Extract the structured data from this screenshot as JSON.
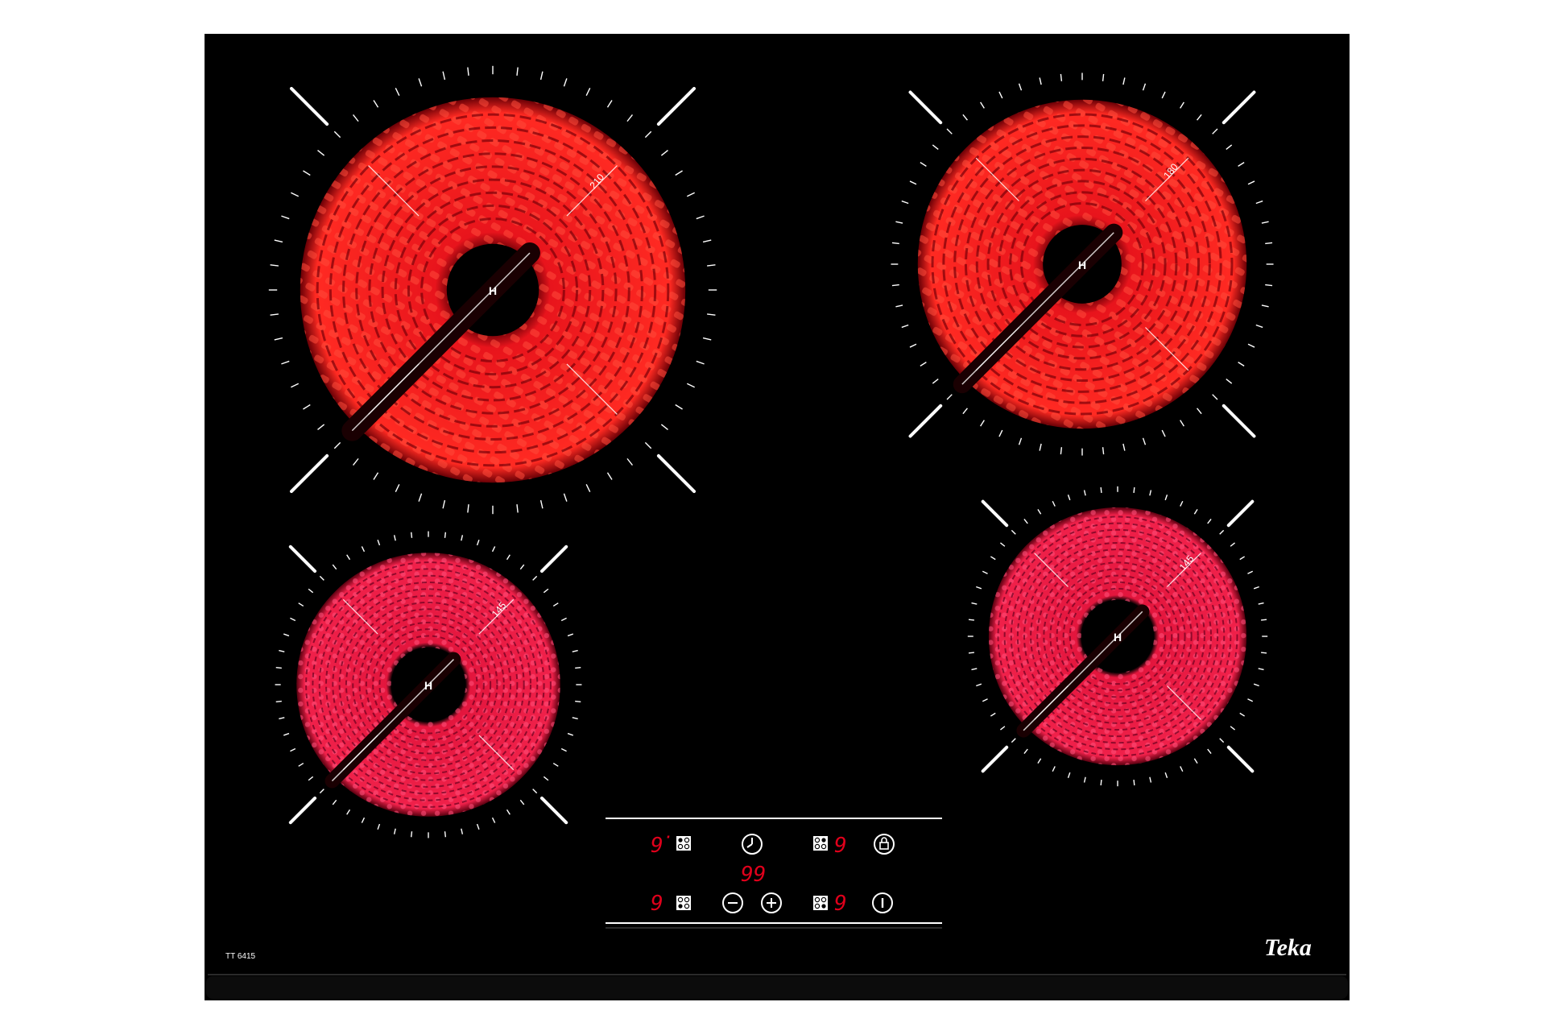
{
  "model": "TT 6415",
  "brand": "Teka",
  "colors": {
    "glass": "#000000",
    "glow": "#e8141c",
    "glow_dim": "#8a0008",
    "display": "#e0001b",
    "marks": "#ffffff"
  },
  "zones": [
    {
      "id": "rear-left",
      "size_label": "210",
      "residual_heat": "H",
      "coil": "radiant"
    },
    {
      "id": "rear-right",
      "size_label": "180",
      "residual_heat": "H",
      "coil": "radiant"
    },
    {
      "id": "front-left",
      "size_label": "145",
      "residual_heat": "H",
      "coil": "spiral"
    },
    {
      "id": "front-right",
      "size_label": "145",
      "residual_heat": "H",
      "coil": "spiral"
    }
  ],
  "controls": {
    "rear_left_display": "9",
    "rear_left_dot": "·",
    "rear_right_display": "9",
    "front_left_display": "9",
    "front_right_display": "9",
    "timer_display": "99",
    "icons": [
      "zone-select-rear-left-icon",
      "timer-clock-icon",
      "zone-select-rear-right-icon",
      "lock-icon",
      "zone-select-front-left-icon",
      "minus-icon",
      "plus-icon",
      "zone-select-front-right-icon",
      "power-icon"
    ]
  }
}
